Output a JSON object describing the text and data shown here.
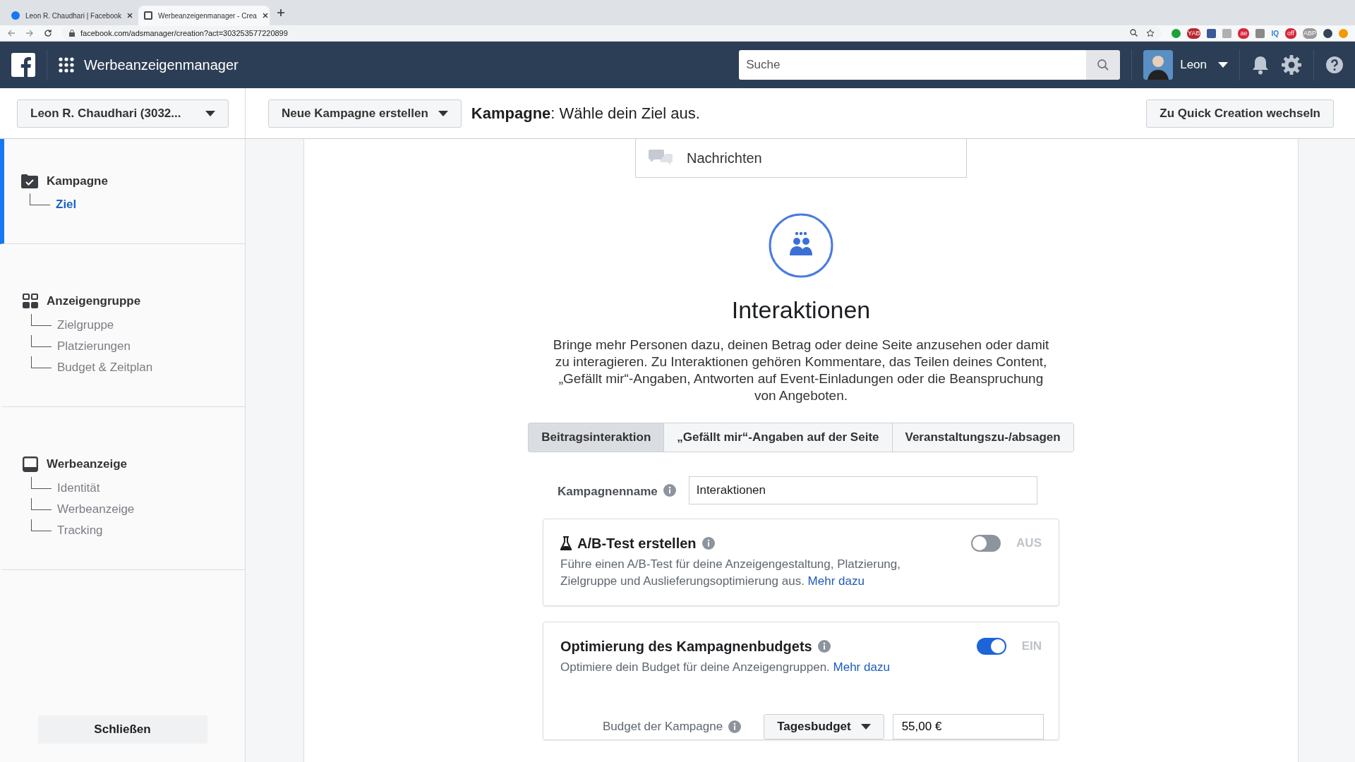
{
  "browser": {
    "tabs": [
      {
        "title": "Leon R. Chaudhari | Facebook",
        "selected": false
      },
      {
        "title": "Werbeanzeigenmanager - Crea",
        "selected": true
      }
    ],
    "url": "facebook.com/adsmanager/creation?act=303253577220899",
    "extensions": [
      {
        "kind": "dot",
        "color": "#1aa33a"
      },
      {
        "kind": "badge",
        "label": "YAB",
        "color": "#b8262d"
      },
      {
        "kind": "square",
        "color": "#3b5998"
      },
      {
        "kind": "square",
        "color": "#b0b0b0"
      },
      {
        "kind": "badge",
        "label": "ae",
        "color": "#d9253a"
      },
      {
        "kind": "square",
        "color": "#8a8a8a"
      },
      {
        "kind": "text",
        "label": "IQ",
        "color": "#2a7fd8"
      },
      {
        "kind": "badge",
        "label": "off",
        "color": "#d9253a"
      },
      {
        "kind": "badge",
        "label": "ABP",
        "color": "#9a9a9a"
      }
    ]
  },
  "header": {
    "app_title": "Werbeanzeigenmanager",
    "search_placeholder": "Suche",
    "user": "Leon"
  },
  "subheader": {
    "account": "Leon R. Chaudhari (3032...",
    "new_campaign": "Neue Kampagne erstellen",
    "title": "**Kampagne**: Wähle dein Ziel aus.",
    "quick_button": "Zu Quick Creation wechseln"
  },
  "sidebar": {
    "sections": [
      {
        "kind": "campaign",
        "title": "Kampagne",
        "active": true,
        "children": [
          {
            "label": "Ziel",
            "selected": true
          }
        ]
      },
      {
        "kind": "adset",
        "title": "Anzeigengruppe",
        "active": false,
        "children": [
          {
            "label": "Zielgruppe",
            "selected": false
          },
          {
            "label": "Platzierungen",
            "selected": false
          },
          {
            "label": "Budget & Zeitplan",
            "selected": false
          }
        ]
      },
      {
        "kind": "ad",
        "title": "Werbeanzeige",
        "active": false,
        "children": [
          {
            "label": "Identität",
            "selected": false
          },
          {
            "label": "Werbeanzeige",
            "selected": false
          },
          {
            "label": "Tracking",
            "selected": false
          }
        ]
      }
    ],
    "close_button": "Schließen"
  },
  "previous_objective": "Nachrichten",
  "objective": {
    "title": "Interaktionen",
    "description": "Bringe mehr Personen dazu, deinen Betrag oder deine Seite anzusehen oder damit zu interagieren. Zu Interaktionen gehören Kommentare, das Teilen deines Content, „Gefällt mir“-Angaben, Antworten auf Event-Einladungen oder die Beanspruchung von Angeboten.",
    "subtypes": [
      {
        "label": "Beitragsinteraktion",
        "selected": true
      },
      {
        "label": "„Gefällt mir“-Angaben auf der Seite",
        "selected": false
      },
      {
        "label": "Veranstaltungszu-/absagen",
        "selected": false
      }
    ],
    "campaign_name_label": "Kampagnenname",
    "campaign_name_value": "Interaktionen"
  },
  "ab_test": {
    "title": "A/B-Test erstellen",
    "description": "Führe einen A/B-Test für deine Anzeigengestaltung, Platzierung, Zielgruppe und Auslieferungsoptimierung aus.",
    "link": "Mehr dazu",
    "on": false,
    "state_label": "AUS"
  },
  "budget_optimization": {
    "title": "Optimierung des Kampagnenbudgets",
    "description": "Optimiere dein Budget für deine Anzeigengruppen.",
    "link": "Mehr dazu",
    "on": true,
    "state_label": "EIN",
    "budget_label": "Budget der Kampagne",
    "budget_type": "Tagesbudget",
    "budget_value": "55,00 €"
  }
}
